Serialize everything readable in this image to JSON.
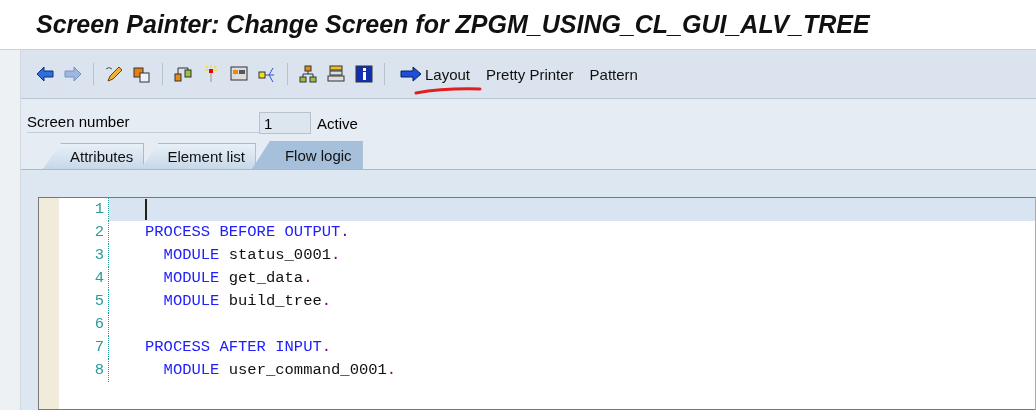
{
  "window": {
    "title": "Screen Painter: Change Screen for ZPGM_USING_CL_GUI_ALV_TREE"
  },
  "toolbar": {
    "buttons": [
      {
        "label": "Layout",
        "kind": "arrow"
      },
      {
        "label": "Pretty Printer",
        "kind": "text"
      },
      {
        "label": "Pattern",
        "kind": "text"
      }
    ]
  },
  "screen": {
    "label": "Screen number",
    "value": "1",
    "status": "Active"
  },
  "tabs": [
    {
      "label": "Attributes",
      "selected": false
    },
    {
      "label": "Element list",
      "selected": false
    },
    {
      "label": "Flow logic",
      "selected": true
    }
  ],
  "editor": {
    "lines": [
      {
        "number": "1",
        "current": true
      },
      {
        "number": "2",
        "current": false,
        "tokens": [
          {
            "kind": "keyword",
            "text": "PROCESS BEFORE OUTPUT"
          },
          {
            "kind": "punct",
            "text": "."
          }
        ]
      },
      {
        "number": "3",
        "current": false,
        "tokens": [
          {
            "kind": "keyword",
            "text": "  MODULE"
          },
          {
            "kind": "ident",
            "text": " status_0001"
          },
          {
            "kind": "punct",
            "text": "."
          }
        ]
      },
      {
        "number": "4",
        "current": false,
        "tokens": [
          {
            "kind": "keyword",
            "text": "  MODULE"
          },
          {
            "kind": "ident",
            "text": " get_data"
          },
          {
            "kind": "punct",
            "text": "."
          }
        ]
      },
      {
        "number": "5",
        "current": false,
        "tokens": [
          {
            "kind": "keyword",
            "text": "  MODULE"
          },
          {
            "kind": "ident",
            "text": " build_tree"
          },
          {
            "kind": "punct",
            "text": "."
          }
        ]
      },
      {
        "number": "6",
        "current": false
      },
      {
        "number": "7",
        "current": false,
        "tokens": [
          {
            "kind": "keyword",
            "text": "PROCESS AFTER INPUT"
          },
          {
            "kind": "punct",
            "text": "."
          }
        ]
      },
      {
        "number": "8",
        "current": false,
        "tokens": [
          {
            "kind": "keyword",
            "text": "  MODULE"
          },
          {
            "kind": "ident",
            "text": " user_command_0001"
          },
          {
            "kind": "punct",
            "text": "."
          }
        ]
      }
    ]
  }
}
